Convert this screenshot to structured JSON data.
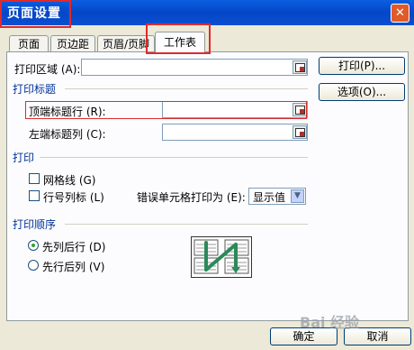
{
  "window": {
    "title": "页面设置",
    "close_glyph": "✕"
  },
  "tabs": [
    {
      "label": "页面",
      "active": false
    },
    {
      "label": "页边距",
      "active": false
    },
    {
      "label": "页眉/页脚",
      "active": false
    },
    {
      "label": "工作表",
      "active": true
    }
  ],
  "print_area": {
    "label": "打印区域 (A):",
    "value": ""
  },
  "buttons": {
    "print": "打印(P)...",
    "options": "选项(O)...",
    "ok": "确定",
    "cancel": "取消"
  },
  "print_titles": {
    "heading": "打印标题",
    "top_rows_label": "顶端标题行 (R):",
    "top_rows_value": "",
    "left_cols_label": "左端标题列 (C):",
    "left_cols_value": ""
  },
  "print_section": {
    "heading": "打印",
    "gridlines": {
      "label": "网格线 (G)",
      "checked": false
    },
    "row_col_headings": {
      "label": "行号列标 (L)",
      "checked": false
    },
    "errors_label": "错误单元格打印为 (E):",
    "errors_value": "显示值"
  },
  "page_order": {
    "heading": "打印顺序",
    "down_then_over": {
      "label": "先列后行 (D)",
      "selected": true
    },
    "over_then_down": {
      "label": "先行后列 (V)",
      "selected": false
    }
  },
  "watermark": "Bai  经验",
  "colors": {
    "titlebar": "#0546c8",
    "highlight": "#e02a2a",
    "heading_blue": "#003399",
    "arrow_green": "#2a8a5a"
  },
  "icons": [
    "close-icon",
    "range-picker-icon",
    "dropdown-arrow-icon",
    "page-order-icon"
  ]
}
